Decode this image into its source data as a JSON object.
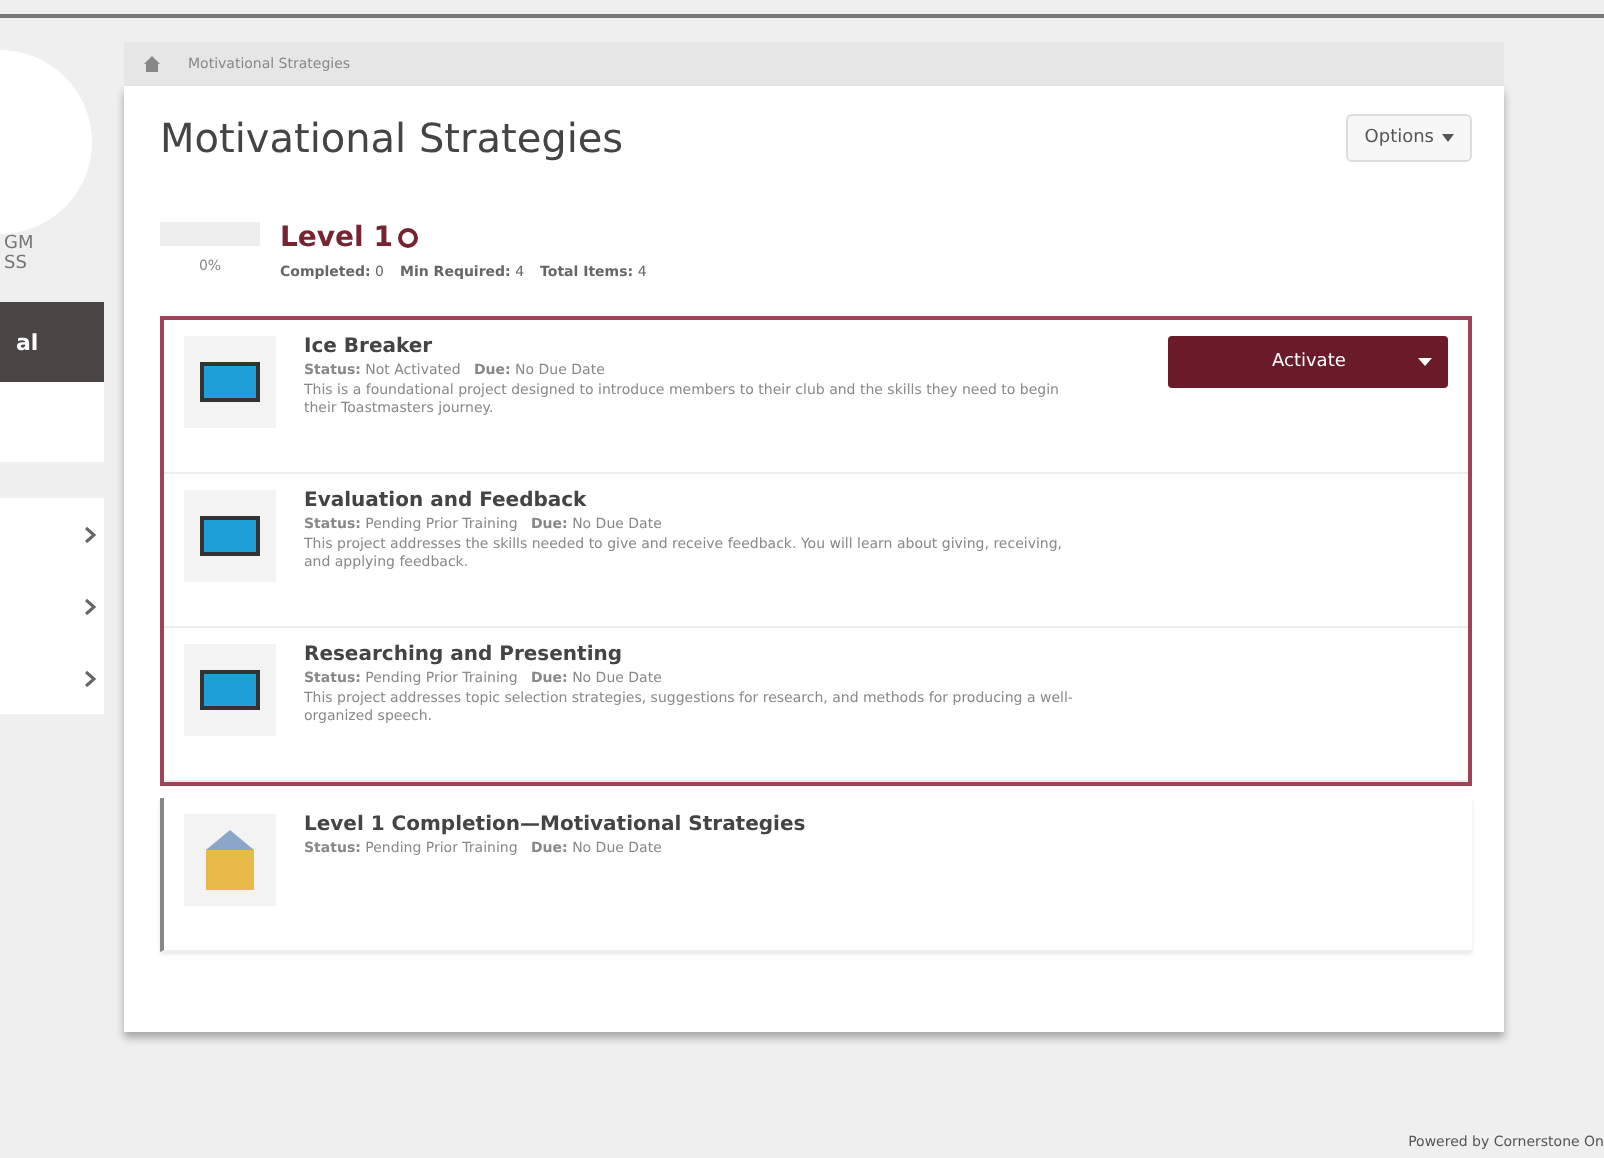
{
  "sidebar": {
    "texts": [
      "GM",
      "SS"
    ],
    "items": [
      {
        "kind": "label",
        "label": "al",
        "selected": true
      },
      {
        "kind": "chevron",
        "selected": false
      },
      {
        "kind": "chevron",
        "selected": false
      },
      {
        "kind": "chevron",
        "selected": false
      }
    ]
  },
  "breadcrumb": {
    "items": [
      "Motivational Strategies"
    ]
  },
  "page": {
    "title": "Motivational Strategies",
    "options_button": "Options"
  },
  "level": {
    "title": "Level 1",
    "percent": "0%",
    "stats": [
      {
        "label": "Completed:",
        "value": "0"
      },
      {
        "label": "Min Required:",
        "value": "4"
      },
      {
        "label": "Total Items:",
        "value": "4"
      }
    ]
  },
  "projects": [
    {
      "kind": "project",
      "title": "Ice Breaker",
      "status_label": "Status:",
      "status": "Not Activated",
      "due_label": "Due:",
      "due": "No Due Date",
      "description": "This is a foundational project designed to introduce members to their club and the skills they need to begin their Toastmasters journey.",
      "highlighted": true,
      "action": "Activate"
    },
    {
      "kind": "project",
      "title": "Evaluation and Feedback",
      "status_label": "Status:",
      "status": "Pending Prior Training",
      "due_label": "Due:",
      "due": "No Due Date",
      "description": "This project addresses the skills needed to give and receive feedback. You will learn about giving, receiving, and applying feedback.",
      "highlighted": true
    },
    {
      "kind": "project",
      "title": "Researching and Presenting",
      "status_label": "Status:",
      "status": "Pending Prior Training",
      "due_label": "Due:",
      "due": "No Due Date",
      "description": "This project addresses topic selection strategies, suggestions for research, and methods for producing a well-organized speech.",
      "highlighted": true
    },
    {
      "kind": "completion",
      "title": "Level 1 Completion—Motivational Strategies",
      "status_label": "Status:",
      "status": "Pending Prior Training",
      "due_label": "Due:",
      "due": "No Due Date",
      "highlighted": false
    }
  ],
  "footer": "Powered by Cornerstone On"
}
